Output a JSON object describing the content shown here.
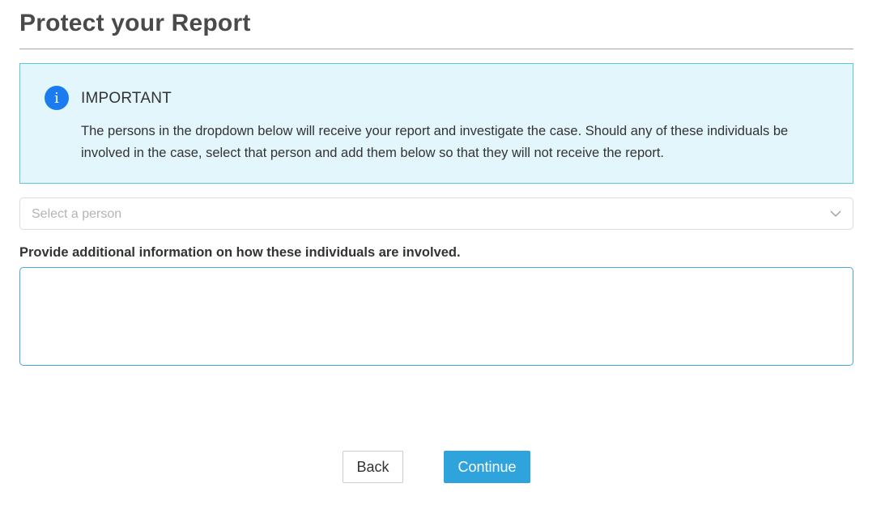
{
  "page": {
    "title": "Protect your Report"
  },
  "alert": {
    "icon": "info-icon",
    "icon_glyph": "i",
    "heading": "IMPORTANT",
    "message": "The persons in the dropdown below will receive your report and investigate the case. Should any of these individuals be involved in the case, select that person and add them below so that they will not receive the report.",
    "colors": {
      "background": "#e2f6fc",
      "border": "#5bc6de",
      "icon": "#1a7cf0"
    }
  },
  "person_select": {
    "placeholder": "Select a person",
    "icon": "chevron-down-icon"
  },
  "additional_info": {
    "label": "Provide additional information on how these individuals are involved.",
    "value": ""
  },
  "actions": {
    "back_label": "Back",
    "continue_label": "Continue",
    "colors": {
      "continue": "#2ea3dc"
    }
  }
}
